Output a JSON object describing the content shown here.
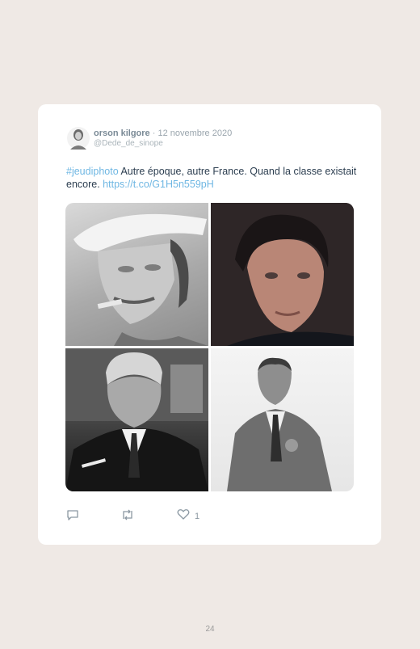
{
  "tweet": {
    "author_name": "orson kilgore",
    "separator": " · ",
    "date": "12 novembre 2020",
    "handle": "@Dede_de_sinope",
    "hashtag": "#jeudiphoto",
    "body": " Autre époque, autre France. Quand la classe existait encore. ",
    "link": "https://t.co/G1H5n559pH",
    "likes": "1"
  },
  "icons": {
    "reply": "reply-icon",
    "retweet": "retweet-icon",
    "like": "heart-icon"
  },
  "photos": [
    "photo-man-white-cap-cigar",
    "photo-man-dark-hair-portrait",
    "photo-man-suit-cigarette",
    "photo-man-tweed-suit"
  ],
  "page": {
    "number": "24"
  }
}
